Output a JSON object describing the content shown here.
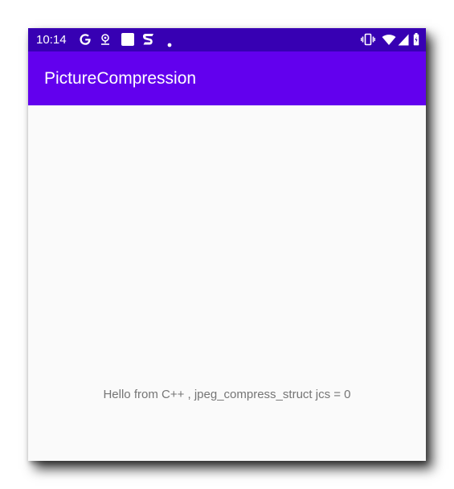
{
  "status_bar": {
    "time": "10:14",
    "left_icons": [
      "google-icon",
      "location-pin-icon",
      "white-square-icon",
      "s-app-icon",
      "dot-icon"
    ],
    "right_icons": [
      "vibrate-icon",
      "wifi-icon",
      "cellular-signal-icon",
      "battery-icon"
    ],
    "background_color": "#3700b3"
  },
  "toolbar": {
    "title": "PictureCompression",
    "background_color": "#6200ee"
  },
  "content": {
    "message": "Hello from C++ , jpeg_compress_struct jcs = 0",
    "text_color": "#757575",
    "background_color": "#fafafa"
  }
}
